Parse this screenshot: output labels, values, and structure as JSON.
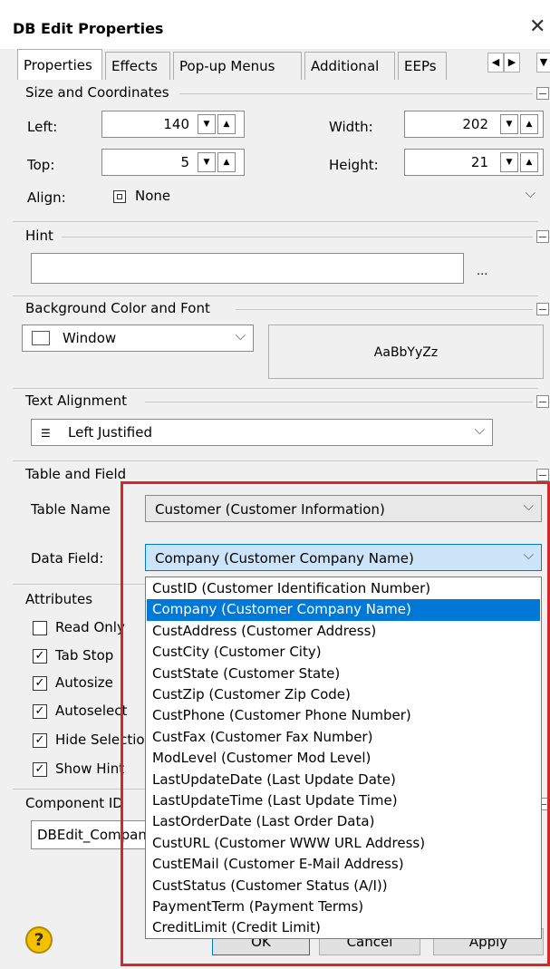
{
  "window": {
    "title": "DB Edit Properties",
    "close_glyph": "✕"
  },
  "tabs": [
    {
      "label": "Properties",
      "active": true
    },
    {
      "label": "Effects"
    },
    {
      "label": "Pop-up Menus"
    },
    {
      "label": "Additional"
    },
    {
      "label": "EEPs"
    }
  ],
  "tab_scroll": {
    "left": "◀",
    "right": "▶",
    "menu": "▼"
  },
  "size": {
    "title": "Size and Coordinates",
    "left_label": "Left:",
    "left_value": "140",
    "width_label": "Width:",
    "width_value": "202",
    "top_label": "Top:",
    "top_value": "5",
    "height_label": "Height:",
    "height_value": "21",
    "align_label": "Align:",
    "align_value": "None"
  },
  "hint": {
    "title": "Hint",
    "value": "",
    "browse": "..."
  },
  "background": {
    "title": "Background Color and Font",
    "color_value": "Window",
    "font_sample": "AaBbYyZz"
  },
  "text_alignment": {
    "title": "Text Alignment",
    "value": "Left Justified"
  },
  "table_field": {
    "title": "Table and Field",
    "table_label": "Table Name",
    "table_value": "Customer  (Customer Information)",
    "field_label": "Data Field:",
    "field_value": "Company  (Customer Company Name)"
  },
  "dropdown_items": [
    "CustID  (Customer Identification Number)",
    "Company  (Customer Company Name)",
    "CustAddress  (Customer Address)",
    "CustCity  (Customer City)",
    "CustState  (Customer State)",
    "CustZip  (Customer Zip Code)",
    "CustPhone  (Customer Phone Number)",
    "CustFax  (Customer Fax Number)",
    "ModLevel  (Customer Mod Level)",
    "LastUpdateDate  (Last Update Date)",
    "LastUpdateTime  (Last Update Time)",
    "LastOrderDate  (Last Order Data)",
    "CustURL  (Customer WWW URL Address)",
    "CustEMail  (Customer E-Mail Address)",
    "CustStatus  (Customer Status (A/I))",
    "PaymentTerm  (Payment Terms)",
    "CreditLimit  (Credit Limit)"
  ],
  "dropdown_selected_index": 1,
  "attributes": {
    "title": "Attributes",
    "items": [
      {
        "label": "Read Only",
        "checked": false
      },
      {
        "label": "Tab Stop",
        "checked": true
      },
      {
        "label": "Autosize",
        "checked": true
      },
      {
        "label": "Autoselect",
        "checked": true
      },
      {
        "label": "Hide Selection",
        "checked": true
      },
      {
        "label": "Show Hint",
        "checked": true
      }
    ]
  },
  "component_id": {
    "title": "Component ID",
    "value": "DBEdit_Company"
  },
  "buttons": {
    "ok": "OK",
    "cancel": "Cancel",
    "apply": "Apply",
    "help": "?"
  },
  "colors": {
    "selection": "#0078d7",
    "highlight_frame": "#d4262b",
    "combo_focus": "#cce4f7"
  }
}
